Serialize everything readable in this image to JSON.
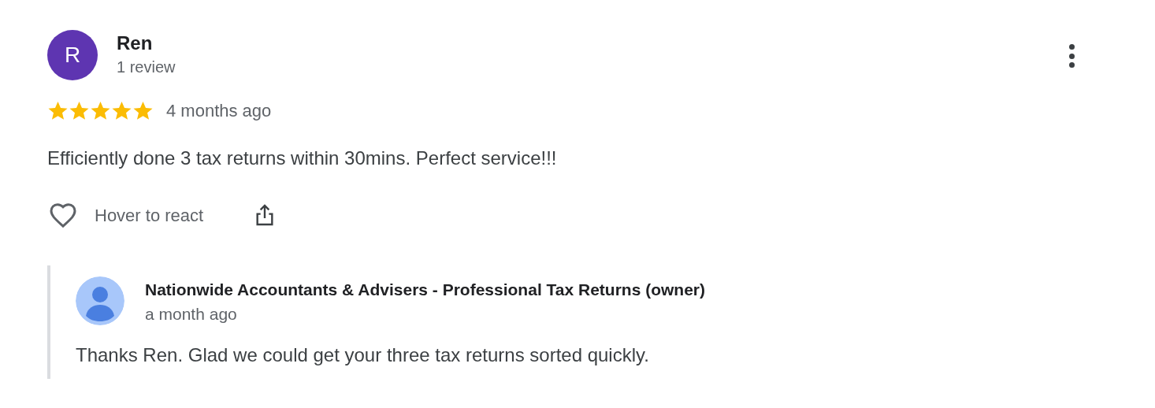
{
  "review": {
    "avatar_letter": "R",
    "author": "Ren",
    "author_meta": "1 review",
    "stars": 5,
    "time": "4 months ago",
    "text": "Efficiently done 3 tax returns within 30mins. Perfect service!!!",
    "react_label": "Hover to react"
  },
  "owner_reply": {
    "author": "Nationwide Accountants & Advisers - Professional Tax Returns (owner)",
    "time": "a month ago",
    "text": "Thanks Ren. Glad we could get your three tax returns sorted quickly."
  }
}
